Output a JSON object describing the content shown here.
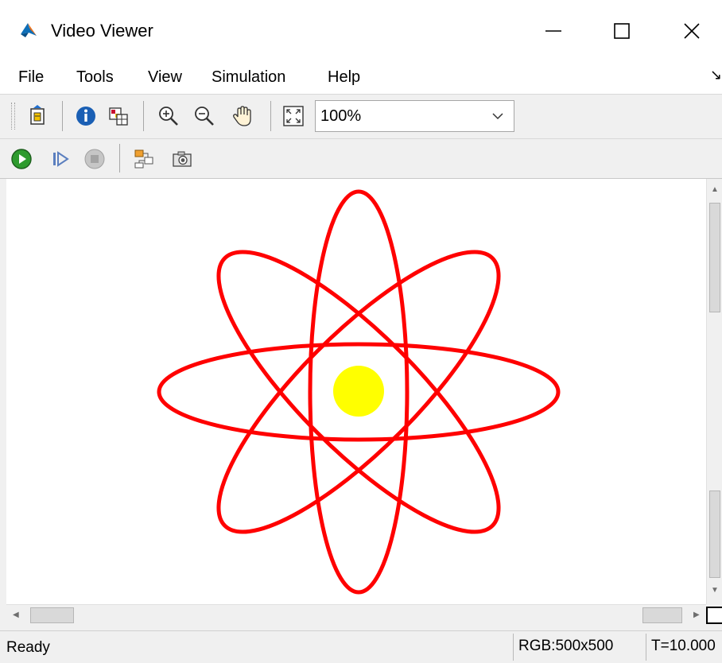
{
  "window": {
    "title": "Video Viewer"
  },
  "menu": {
    "items": [
      "File",
      "Tools",
      "View",
      "Simulation",
      "Help"
    ]
  },
  "toolbar": {
    "zoom_value": "100%",
    "buttons_row1": [
      "parameters-icon",
      "info-icon",
      "pixel-region-icon",
      "zoom-in-icon",
      "zoom-out-icon",
      "pan-hand-icon",
      "fit-to-view-icon"
    ],
    "buttons_row2": [
      "run-icon",
      "step-forward-icon",
      "stop-icon",
      "highlight-block-icon",
      "snapshot-camera-icon"
    ]
  },
  "viewer": {
    "orbit_color": "#ff0000",
    "nucleus_color": "#ffff00",
    "background": "#ffffff"
  },
  "status": {
    "text": "Ready",
    "resolution": "RGB:500x500",
    "time": "T=10.000"
  }
}
